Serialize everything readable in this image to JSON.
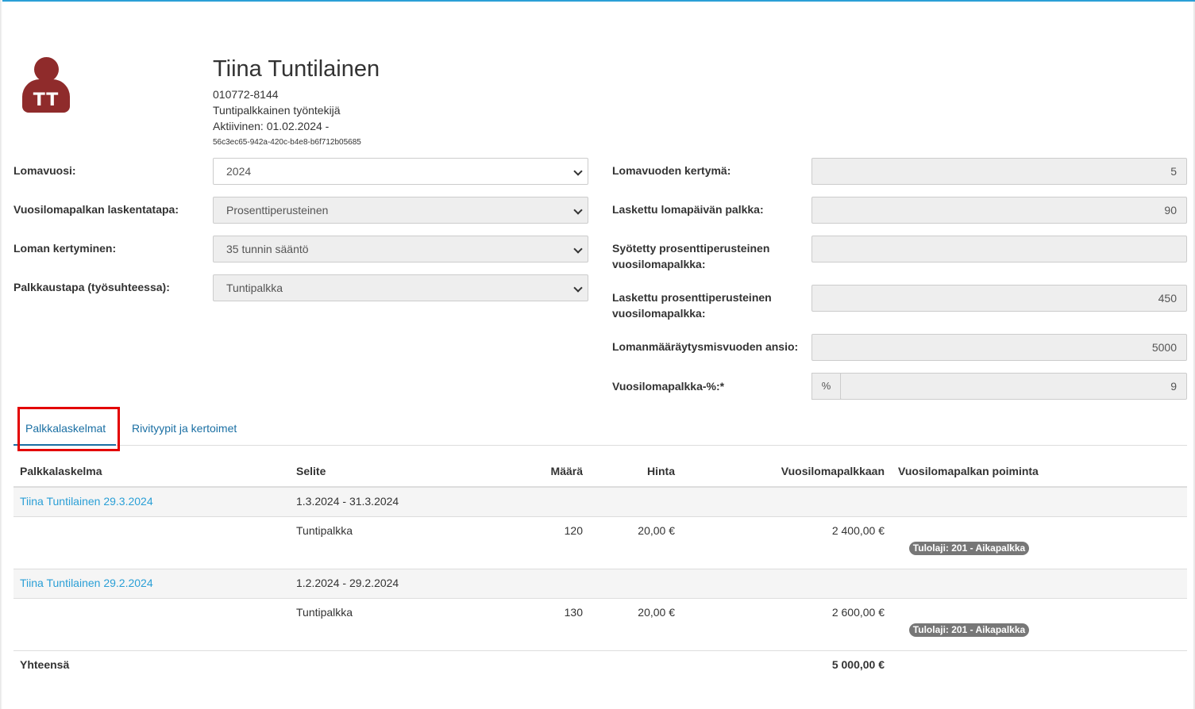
{
  "employee": {
    "initials": "TT",
    "name": "Tiina Tuntilainen",
    "ssn": "010772-8144",
    "type": "Tuntipalkkainen työntekijä",
    "active": "Aktiivinen: 01.02.2024 -",
    "uuid": "56c3ec65-942a-420c-b4e8-b6f712b05685"
  },
  "form": {
    "lomavuosi": {
      "label": "Lomavuosi:",
      "value": "2024"
    },
    "laskentatapa": {
      "label": "Vuosilomapalkan laskentatapa:",
      "value": "Prosenttiperusteinen"
    },
    "kertyminen": {
      "label": "Loman kertyminen:",
      "value": "35 tunnin sääntö"
    },
    "palkkaustapa": {
      "label": "Palkkaustapa (työsuhteessa):",
      "value": "Tuntipalkka"
    },
    "kertyma": {
      "label": "Lomavuoden kertymä:",
      "value": "5"
    },
    "lomapaivanPalkka": {
      "label": "Laskettu lomapäivän palkka:",
      "value": "90"
    },
    "syotetty": {
      "label1": "Syötetty prosenttiperusteinen",
      "label2": "vuosilomapalkka:",
      "value": ""
    },
    "laskettu": {
      "label1": "Laskettu prosenttiperusteinen",
      "label2": "vuosilomapalkka:",
      "value": "450"
    },
    "ansio": {
      "label": "Lomanmääräytysmisvuoden ansio:",
      "value": "5000"
    },
    "prosentti": {
      "label": "Vuosilomapalkka-%:*",
      "addon": "%",
      "value": "9"
    }
  },
  "tabs": [
    {
      "label": "Palkkalaskelmat",
      "active": true
    },
    {
      "label": "Rivityypit ja kertoimet",
      "active": false
    }
  ],
  "table": {
    "headers": {
      "palkkalaskelma": "Palkkalaskelma",
      "selite": "Selite",
      "maara": "Määrä",
      "hinta": "Hinta",
      "vuosilomapalkkaan": "Vuosilomapalkkaan",
      "poiminta": "Vuosilomapalkan poiminta"
    },
    "groups": [
      {
        "title": "Tiina Tuntilainen 29.3.2024",
        "period": "1.3.2024 - 31.3.2024",
        "row": {
          "selite": "Tuntipalkka",
          "maara": "120",
          "hinta": "20,00 €",
          "summa": "2 400,00 €",
          "badge": "Tulolaji: 201 - Aikapalkka"
        }
      },
      {
        "title": "Tiina Tuntilainen 29.2.2024",
        "period": "1.2.2024 - 29.2.2024",
        "row": {
          "selite": "Tuntipalkka",
          "maara": "130",
          "hinta": "20,00 €",
          "summa": "2 600,00 €",
          "badge": "Tulolaji: 201 - Aikapalkka"
        }
      }
    ],
    "total": {
      "label": "Yhteensä",
      "value": "5 000,00 €"
    }
  },
  "colors": {
    "accent": "#2a9fd6",
    "avatar": "#8f2b2b",
    "highlight": "#e30000",
    "badge": "#777777"
  }
}
